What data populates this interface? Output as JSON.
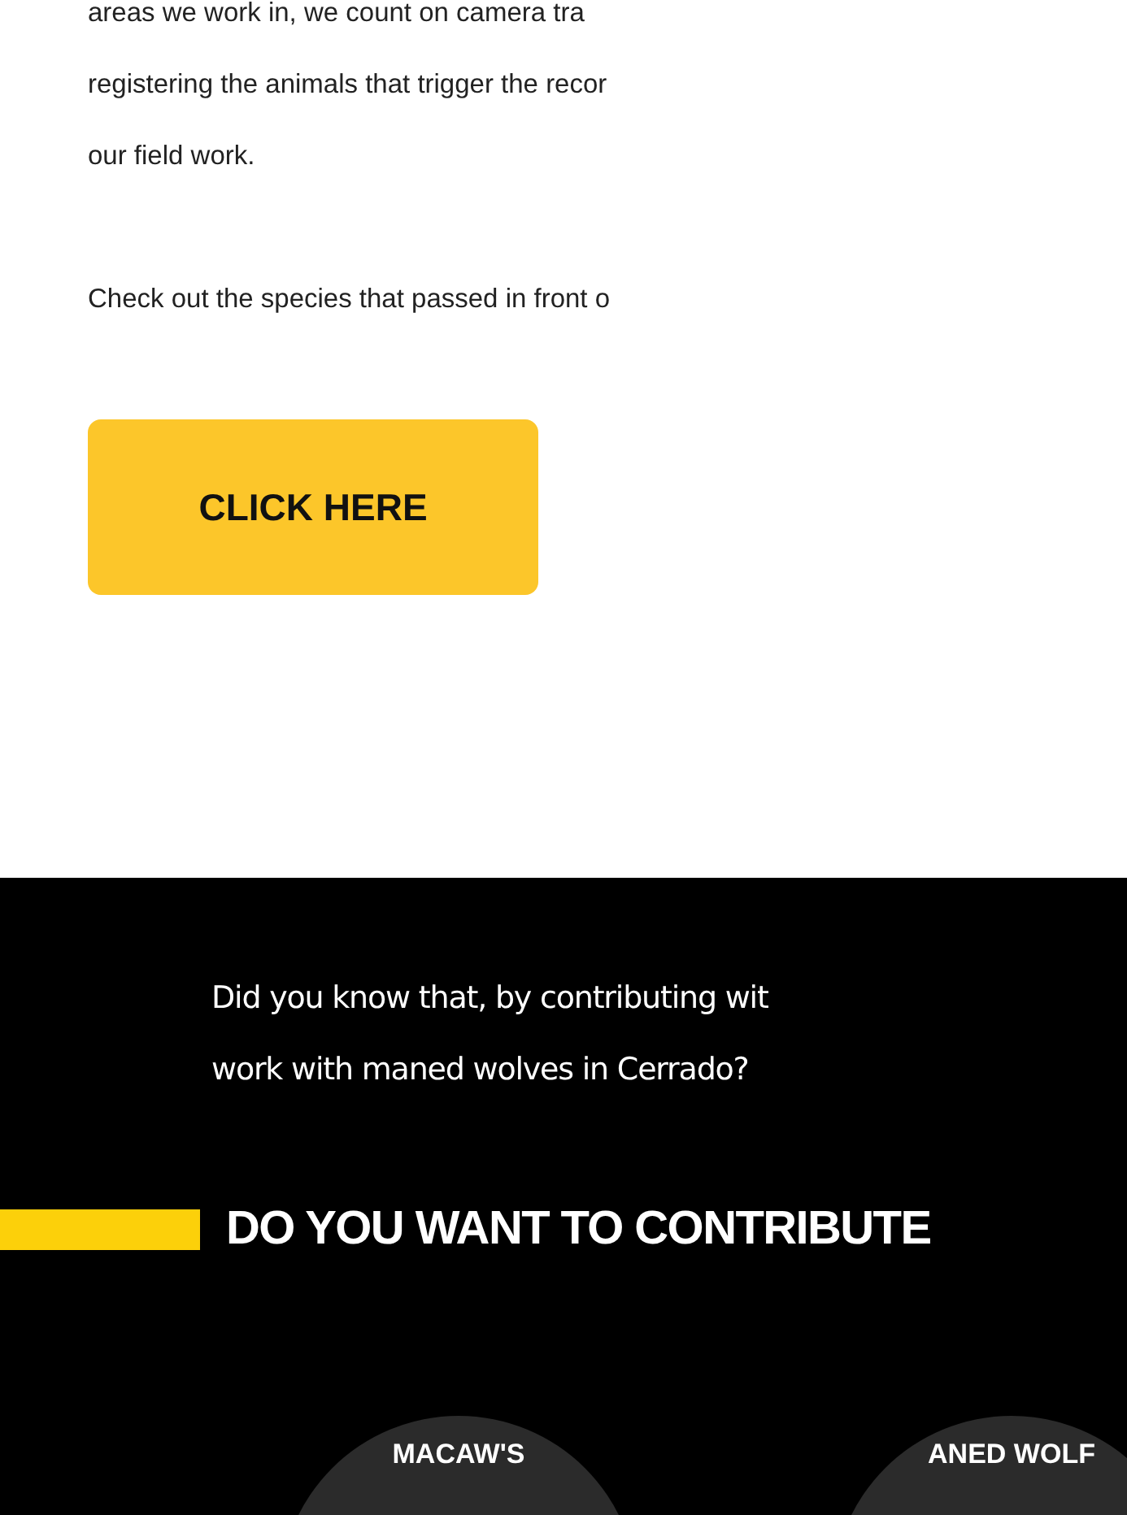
{
  "intro": {
    "lines": [
      "areas we work in, we count on camera tra",
      "registering the animals that trigger the recor",
      "our field work."
    ]
  },
  "prompt": "Check out the species that passed in front o",
  "cta_button": "CLICK HERE",
  "footer": {
    "lines": [
      "Did you know that, by contributing wit",
      "work with maned wolves in Cerrado?"
    ],
    "heading": "DO YOU WANT TO CONTRIBUTE",
    "badges": [
      {
        "label": "MACAW'S"
      },
      {
        "label": "ANED WOLF"
      }
    ]
  }
}
